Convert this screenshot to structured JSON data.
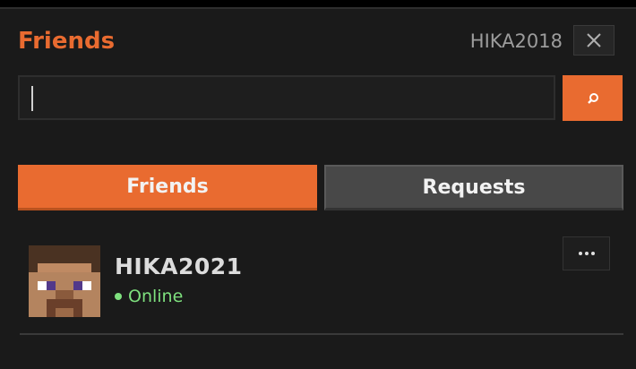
{
  "header": {
    "title": "Friends",
    "username": "HIKA2018",
    "close_icon": "close-icon"
  },
  "search": {
    "placeholder": "",
    "value": "",
    "button_icon": "search-icon"
  },
  "tabs": [
    {
      "label": "Friends",
      "active": true
    },
    {
      "label": "Requests",
      "active": false
    }
  ],
  "friends": [
    {
      "name": "HIKA2021",
      "status": "Online",
      "avatar_icon": "steve-avatar-icon",
      "more_icon": "more-options-icon"
    }
  ],
  "colors": {
    "accent": "#e96b30",
    "online": "#7ee07e",
    "panel_bg": "#1a1a1a"
  }
}
